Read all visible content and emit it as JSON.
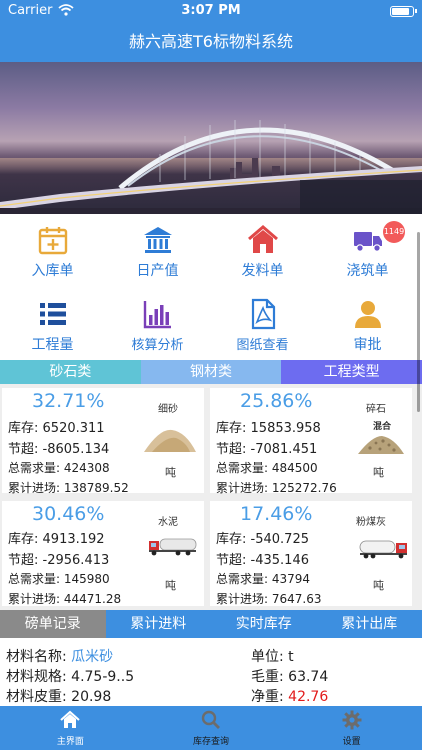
{
  "status_bar": {
    "carrier": "Carrier",
    "time": "3:07 PM"
  },
  "app": {
    "title": "赫六高速T6标物料系统"
  },
  "menu": [
    {
      "label": "入库单",
      "icon": "calendar-add-icon"
    },
    {
      "label": "日产值",
      "icon": "bank-icon"
    },
    {
      "label": "发料单",
      "icon": "home-icon"
    },
    {
      "label": "浇筑单",
      "icon": "truck-icon",
      "badge": "1149"
    },
    {
      "label": "工程量",
      "icon": "list-icon"
    },
    {
      "label": "核算分析",
      "icon": "bar-chart-icon"
    },
    {
      "label": "图纸查看",
      "icon": "pdf-file-icon"
    },
    {
      "label": "审批",
      "icon": "user-icon"
    }
  ],
  "category_tabs": [
    {
      "label": "砂石类",
      "color": "#5fc4d6"
    },
    {
      "label": "钢材类",
      "color": "#86b8ef"
    },
    {
      "label": "工程类型",
      "color": "#6d6cf0"
    }
  ],
  "cards": [
    {
      "percent": "32.71%",
      "name": "细砂",
      "stock_label": "库存:",
      "stock": "6520.311",
      "saving_label": "节超:",
      "saving": "-8605.134",
      "demand_label": "总需求量:",
      "demand": "424308",
      "inflow_label": "累计进场:",
      "inflow": "138789.52",
      "unit": "吨"
    },
    {
      "percent": "25.86%",
      "name": "碎石",
      "image_text": "混合",
      "stock_label": "库存:",
      "stock": "15853.958",
      "saving_label": "节超:",
      "saving": "-7081.451",
      "demand_label": "总需求量:",
      "demand": "484500",
      "inflow_label": "累计进场:",
      "inflow": "125272.76",
      "unit": "吨"
    },
    {
      "percent": "30.46%",
      "name": "水泥",
      "stock_label": "库存:",
      "stock": "4913.192",
      "saving_label": "节超:",
      "saving": "-2956.413",
      "demand_label": "总需求量:",
      "demand": "145980",
      "inflow_label": "累计进场:",
      "inflow": "44471.28",
      "unit": "吨"
    },
    {
      "percent": "17.46%",
      "name": "粉煤灰",
      "stock_label": "库存:",
      "stock": "-540.725",
      "saving_label": "节超:",
      "saving": "-435.146",
      "demand_label": "总需求量:",
      "demand": "43794",
      "inflow_label": "累计进场:",
      "inflow": "7647.63",
      "unit": "吨"
    }
  ],
  "record_tabs": [
    "磅单记录",
    "累计进料",
    "实时库存",
    "累计出库"
  ],
  "record": {
    "name_label": "材料名称:",
    "name": "瓜米砂",
    "spec_label": "材料规格:",
    "spec": "4.75-9..5",
    "tare_label": "材料皮重:",
    "tare": "20.98",
    "unit_label": "单位:",
    "unit": "t",
    "gross_label": "毛重:",
    "gross": "63.74",
    "net_label": "净重:",
    "net": "42.76"
  },
  "tab_bar": [
    {
      "label": "主界面",
      "icon": "home-icon",
      "active": true
    },
    {
      "label": "库存查询",
      "icon": "search-icon",
      "active": false
    },
    {
      "label": "设置",
      "icon": "gear-icon",
      "active": false
    }
  ]
}
